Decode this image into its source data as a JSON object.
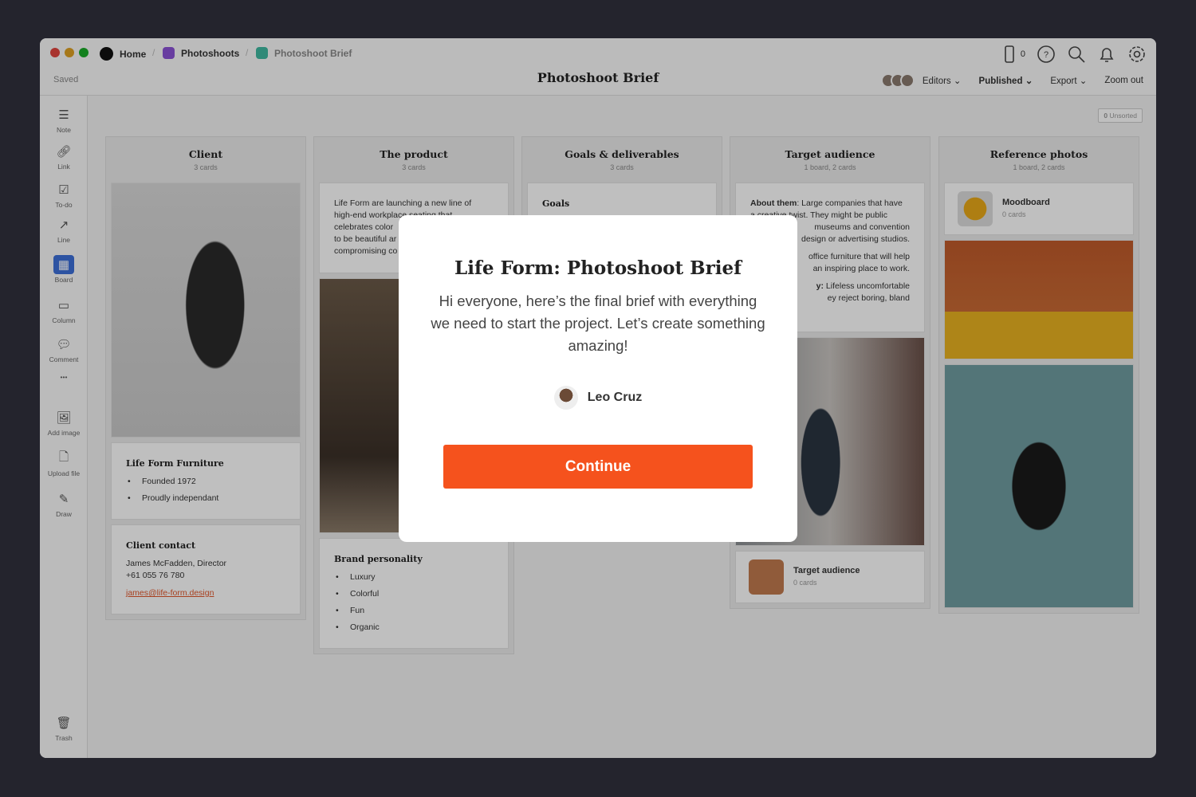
{
  "breadcrumb": {
    "home": "Home",
    "photoshoots": "Photoshoots",
    "current": "Photoshoot Brief"
  },
  "header": {
    "status": "Saved",
    "title": "Photoshoot Brief",
    "device_count": "0",
    "editors": "Editors",
    "published": "Published",
    "export": "Export",
    "zoom": "Zoom out"
  },
  "toolbar": {
    "note": "Note",
    "link": "Link",
    "todo": "To-do",
    "line": "Line",
    "board": "Board",
    "column": "Column",
    "comment": "Comment",
    "more": "•••",
    "add_image": "Add image",
    "upload_file": "Upload file",
    "draw": "Draw",
    "trash": "Trash"
  },
  "canvas": {
    "unsorted_count": "0",
    "unsorted": "Unsorted"
  },
  "columns": {
    "client": {
      "title": "Client",
      "count": "3 cards",
      "company": "Life Form Furniture",
      "bullets": [
        "Founded 1972",
        "Proudly independant"
      ],
      "contact_title": "Client contact",
      "contact_name": "James McFadden, Director",
      "contact_phone": "+61 055 76 780",
      "contact_email": "james@life-form.design"
    },
    "product": {
      "title": "The product",
      "count": "3 cards",
      "text": [
        "Life Form are launching a new line of",
        "high-end workplace seating that",
        "celebrates color",
        "to be beautiful ar",
        "compromising co"
      ],
      "brand_title": "Brand personality",
      "brand": [
        "Luxury",
        "Colorful",
        "Fun",
        "Organic"
      ]
    },
    "goals": {
      "title": "Goals & deliverables",
      "count": "3 cards",
      "goals_title": "Goals"
    },
    "audience": {
      "title": "Target audience",
      "count": "1 board, 2 cards",
      "about_label": "About them",
      "about": [
        ": Large companies that have",
        "a creative twist. They might be public",
        "museums and convention",
        "design or advertising studios."
      ],
      "need": [
        "office furniture that will help",
        "an inspiring place to work."
      ],
      "enemy_label": "y:",
      "enemy": [
        " Lifeless uncomfortable",
        "ey reject boring, bland"
      ],
      "board_title": "Target audience",
      "board_count": "0 cards"
    },
    "reference": {
      "title": "Reference photos",
      "count": "1 board, 2 cards",
      "board_title": "Moodboard",
      "board_count": "0 cards"
    }
  },
  "modal": {
    "title": "Life Form: Photoshoot Brief",
    "body": "Hi everyone, here’s the final brief with everything we need to start the project. Let’s create something amazing!",
    "author": "Leo Cruz",
    "button": "Continue",
    "button_color": "#f5521d"
  }
}
